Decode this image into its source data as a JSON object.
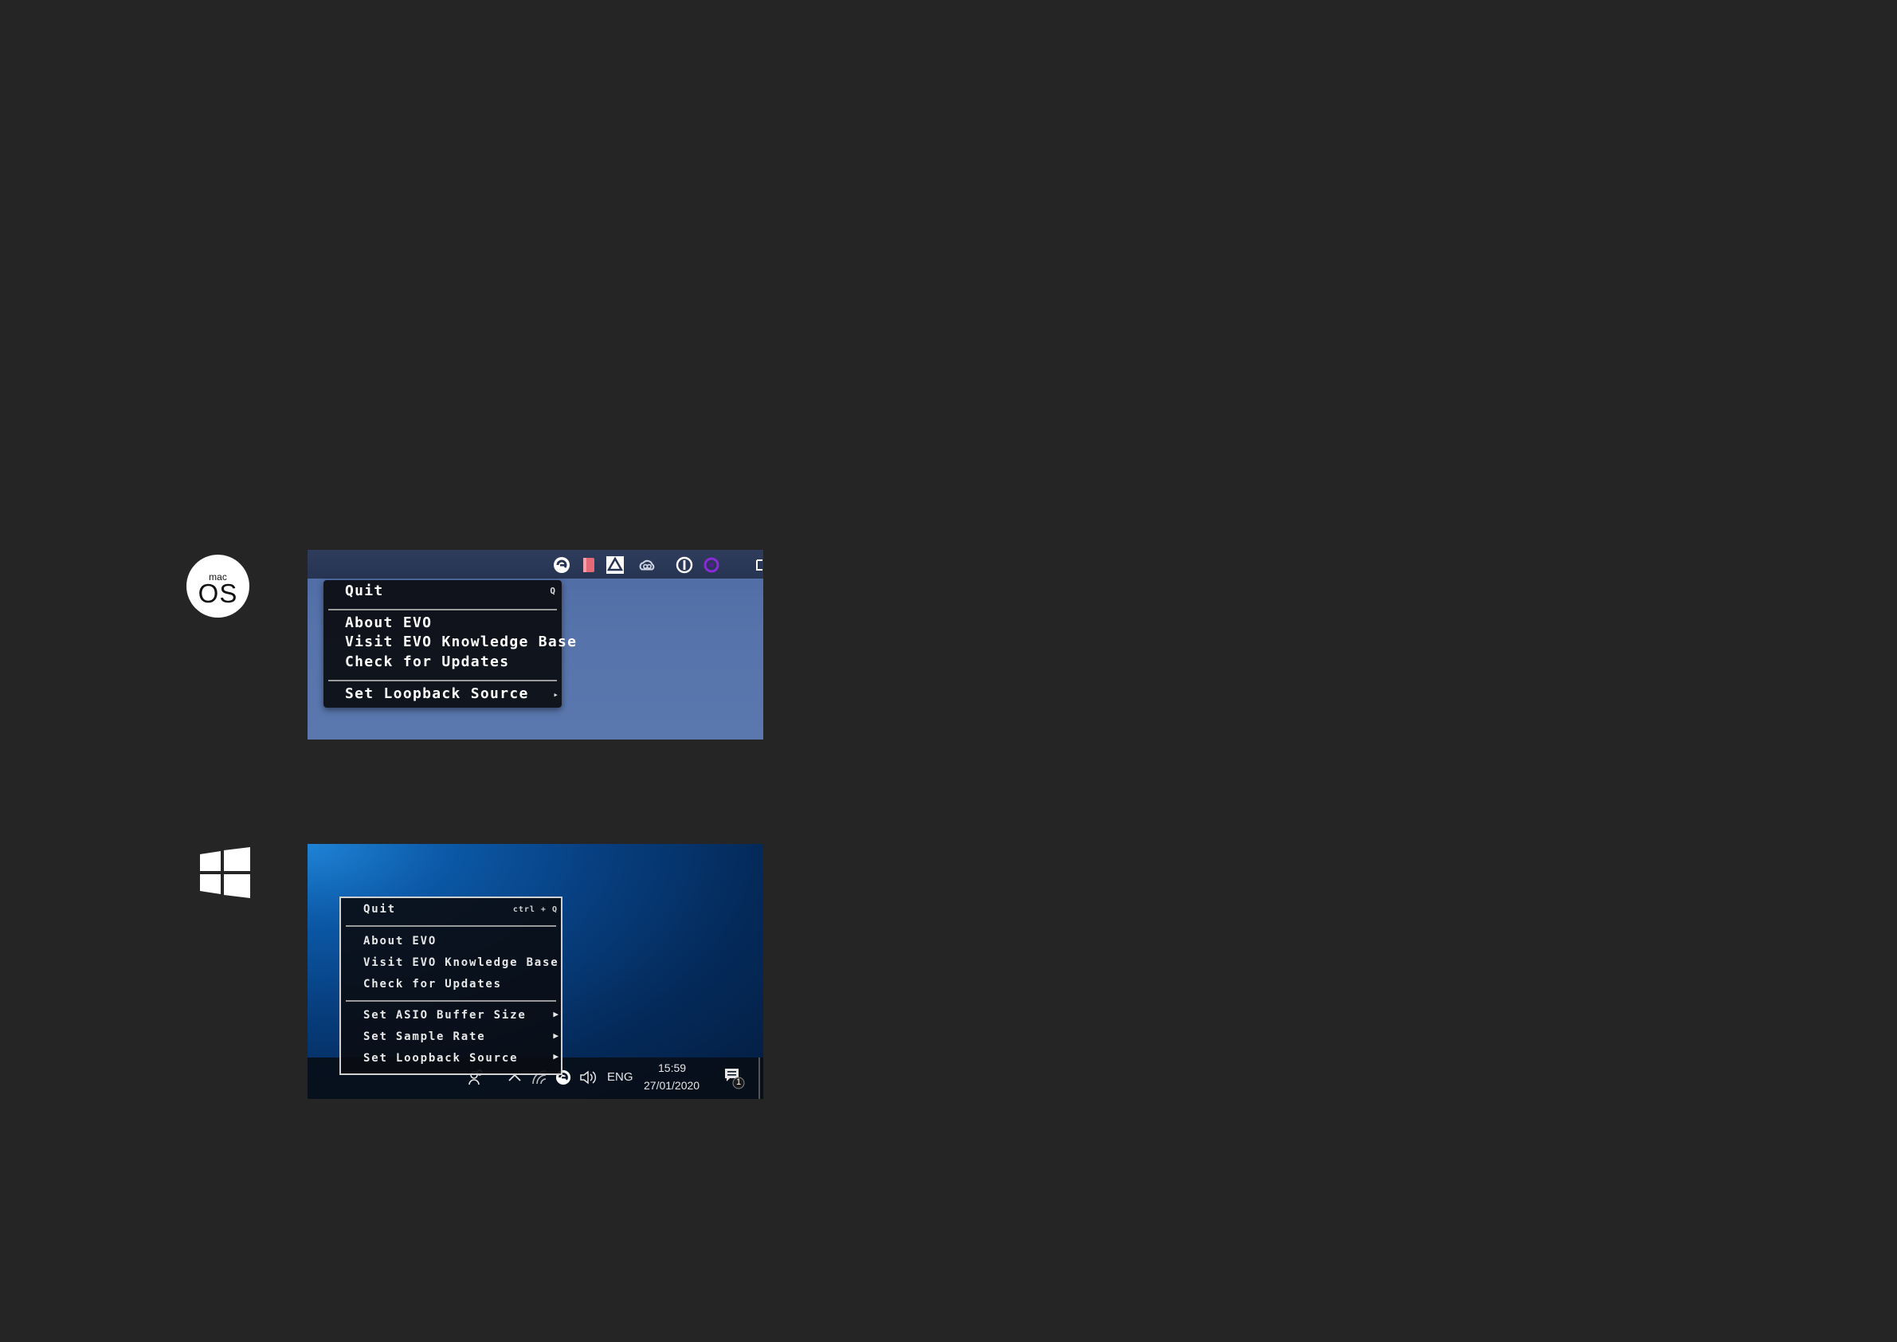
{
  "mac": {
    "logo_small": "mac",
    "logo_big": "OS",
    "menu": {
      "quit": "Quit",
      "quit_shortcut": "Q",
      "about": "About EVO",
      "kb": "Visit EVO Knowledge Base",
      "updates": "Check for Updates",
      "loopback": "Set Loopback Source"
    },
    "tray_icons": [
      "evo-icon",
      "red-app-icon",
      "drive-icon",
      "creative-cloud-icon",
      "info-icon",
      "purple-sync-icon"
    ]
  },
  "windows": {
    "menu": {
      "quit": "Quit",
      "quit_shortcut": "ctrl + Q",
      "about": "About EVO",
      "kb": "Visit EVO Knowledge Base",
      "updates": "Check for Updates",
      "asio": "Set ASIO Buffer Size",
      "sample_rate": "Set Sample Rate",
      "loopback": "Set Loopback Source"
    },
    "taskbar": {
      "language": "ENG",
      "time": "15:59",
      "date": "27/01/2020",
      "notification_count": "1"
    }
  },
  "colors": {
    "background": "#252525",
    "mac_desktop": "#5674ab",
    "win_desktop": "#0b58a6",
    "menu_bg": "#0e1016",
    "menu_text": "#ffffff"
  }
}
